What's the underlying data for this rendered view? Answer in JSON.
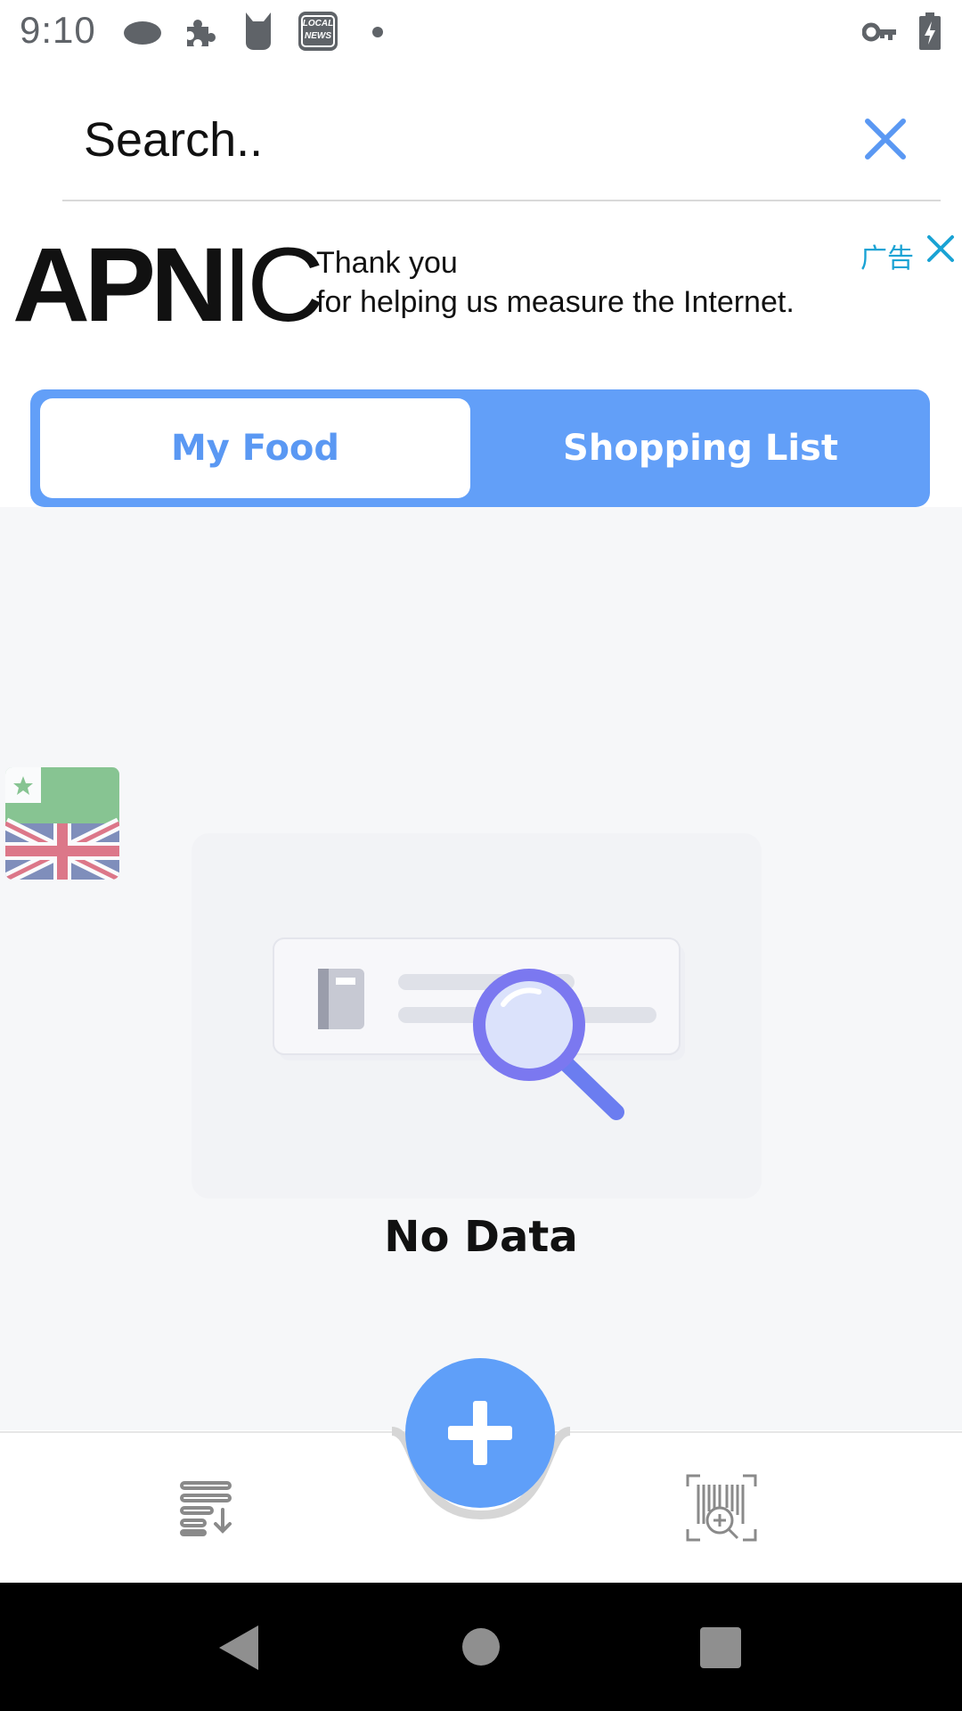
{
  "status_bar": {
    "time": "9:10",
    "icons": [
      "cloud-icon",
      "puzzle-icon",
      "cat-icon",
      "local-news-icon",
      "dot-icon",
      "vpn-key-icon",
      "battery-charging-icon"
    ],
    "news_badge_line1": "LOCAL",
    "news_badge_line2": "NEWS"
  },
  "search": {
    "placeholder": "Search..",
    "value": "",
    "clear_icon": "close-icon",
    "accent": "#5a98f3"
  },
  "ad": {
    "logo_part1": "APN",
    "logo_part2": "IC",
    "line1": "Thank you",
    "line2": "for helping us measure the Internet.",
    "badge": "广告",
    "close_icon": "close-icon",
    "badge_color": "#1aa3d4"
  },
  "tabs": [
    {
      "label": "My Food",
      "active": true
    },
    {
      "label": "Shopping List",
      "active": false
    }
  ],
  "tab_color": "#629ff8",
  "language_button": {
    "icon": "esperanto-uk-flag-icon"
  },
  "empty_state": {
    "icon": "empty-search-illustration",
    "text": "No Data"
  },
  "bottom_nav": {
    "left_icon": "list-sort-down-icon",
    "fab_icon": "plus-icon",
    "right_icon": "barcode-scan-search-icon",
    "fab_color": "#5f9ff9"
  },
  "system_nav": {
    "back_icon": "back-triangle-icon",
    "home_icon": "home-circle-icon",
    "recents_icon": "recents-square-icon"
  }
}
